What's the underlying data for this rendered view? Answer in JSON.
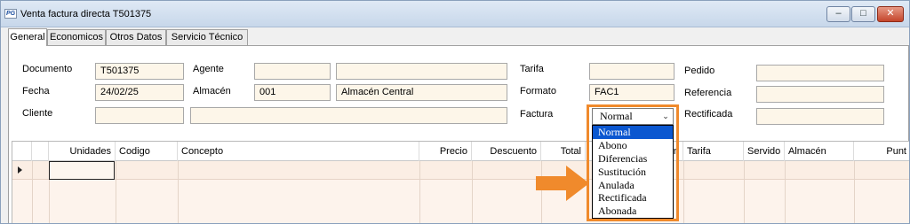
{
  "window": {
    "app_icon": "PG",
    "title": "Venta factura directa T501375",
    "buttons": [
      "minimize-icon",
      "maximize-icon",
      "close-icon"
    ]
  },
  "tabs": [
    {
      "label": "General",
      "active": true
    },
    {
      "label": "Economicos",
      "active": false
    },
    {
      "label": "Otros Datos",
      "active": false
    },
    {
      "label": "Servicio Técnico",
      "active": false
    }
  ],
  "form": {
    "documento": {
      "label": "Documento",
      "value": "T501375"
    },
    "fecha": {
      "label": "Fecha",
      "value": "24/02/25"
    },
    "cliente": {
      "label": "Cliente",
      "code": "",
      "name": ""
    },
    "agente": {
      "label": "Agente",
      "code": "",
      "name": ""
    },
    "almacen": {
      "label": "Almacén",
      "code": "001",
      "name": "Almacén Central"
    },
    "tarifa": {
      "label": "Tarifa",
      "value": ""
    },
    "formato": {
      "label": "Formato",
      "value": "FAC1"
    },
    "factura": {
      "label": "Factura",
      "value": "Normal"
    },
    "pedido": {
      "label": "Pedido",
      "value": ""
    },
    "referencia": {
      "label": "Referencia",
      "value": ""
    },
    "rectificada": {
      "label": "Rectificada",
      "value": ""
    }
  },
  "factura_options": [
    "Normal",
    "Abono",
    "Diferencias",
    "Sustitución",
    "Anulada",
    "Rectificada",
    "Abonada"
  ],
  "grid": {
    "columns": [
      "Unidades",
      "Codigo",
      "Concepto",
      "Precio",
      "Descuento",
      "Total",
      "n",
      "Tarifa",
      "Servido",
      "Almacén",
      "Punt"
    ]
  },
  "colors": {
    "accent_orange": "#f08a2c",
    "selection_blue": "#0b57d0",
    "field_bg": "#fdf6e9"
  }
}
